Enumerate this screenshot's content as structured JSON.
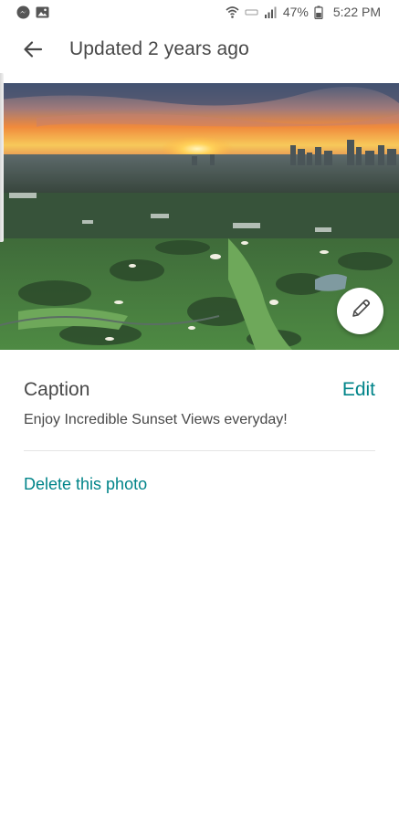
{
  "status_bar": {
    "battery": "47%",
    "time": "5:22 PM",
    "icons": [
      "messenger-icon",
      "gallery-icon",
      "wifi-icon",
      "volte-icon",
      "signal-icon",
      "battery-icon"
    ]
  },
  "header": {
    "title": "Updated 2 years ago",
    "back_icon": "arrow-left-icon"
  },
  "photo": {
    "edit_icon": "pencil-icon"
  },
  "caption": {
    "heading": "Caption",
    "edit_label": "Edit",
    "text": "Enjoy Incredible Sunset Views everyday!"
  },
  "actions": {
    "delete_label": "Delete this photo"
  },
  "colors": {
    "accent": "#008489",
    "text": "#484848",
    "divider": "#e4e4e4"
  }
}
